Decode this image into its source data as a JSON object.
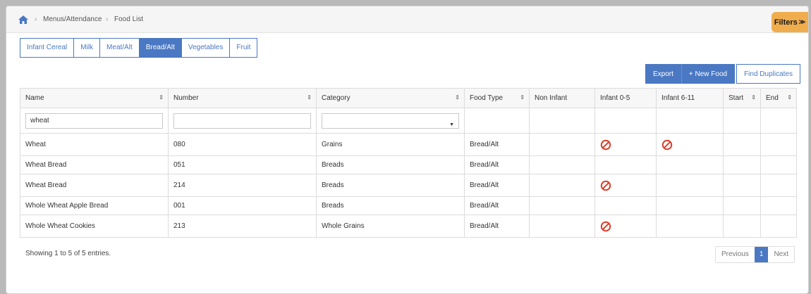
{
  "breadcrumb": {
    "section": "Menus/Attendance",
    "page": "Food List"
  },
  "filters_label": "Filters",
  "tabs": [
    {
      "label": "Infant Cereal",
      "active": false
    },
    {
      "label": "Milk",
      "active": false
    },
    {
      "label": "Meat/Alt",
      "active": false
    },
    {
      "label": "Bread/Alt",
      "active": true
    },
    {
      "label": "Vegetables",
      "active": false
    },
    {
      "label": "Fruit",
      "active": false
    }
  ],
  "actions": {
    "export": "Export",
    "new_food": "+ New Food",
    "find_duplicates": "Find Duplicates"
  },
  "table": {
    "columns": [
      "Name",
      "Number",
      "Category",
      "Food Type",
      "Non Infant",
      "Infant 0-5",
      "Infant 6-11",
      "Start",
      "End"
    ],
    "filter": {
      "name_value": "wheat",
      "number_value": "",
      "category_value": ""
    },
    "rows": [
      {
        "name": "Wheat",
        "number": "080",
        "category": "Grains",
        "food_type": "Bread/Alt",
        "non_infant": "",
        "infant_0_5": "not-allowed-icon",
        "infant_6_11": "not-allowed-icon",
        "start": "",
        "end": ""
      },
      {
        "name": "Wheat Bread",
        "number": "051",
        "category": "Breads",
        "food_type": "Bread/Alt",
        "non_infant": "",
        "infant_0_5": "",
        "infant_6_11": "",
        "start": "",
        "end": ""
      },
      {
        "name": "Wheat Bread",
        "number": "214",
        "category": "Breads",
        "food_type": "Bread/Alt",
        "non_infant": "",
        "infant_0_5": "not-allowed-icon",
        "infant_6_11": "",
        "start": "",
        "end": ""
      },
      {
        "name": "Whole Wheat Apple Bread",
        "number": "001",
        "category": "Breads",
        "food_type": "Bread/Alt",
        "non_infant": "",
        "infant_0_5": "",
        "infant_6_11": "",
        "start": "",
        "end": ""
      },
      {
        "name": "Whole Wheat Cookies",
        "number": "213",
        "category": "Whole Grains",
        "food_type": "Bread/Alt",
        "non_infant": "",
        "infant_0_5": "not-allowed-icon",
        "infant_6_11": "",
        "start": "",
        "end": ""
      }
    ]
  },
  "info_text": "Showing 1 to 5 of 5 entries.",
  "pagination": {
    "previous": "Previous",
    "current": "1",
    "next": "Next"
  },
  "colors": {
    "accent": "#4a78c2",
    "filters_tab": "#f0ad4e",
    "not_allowed": "#d9412e"
  }
}
